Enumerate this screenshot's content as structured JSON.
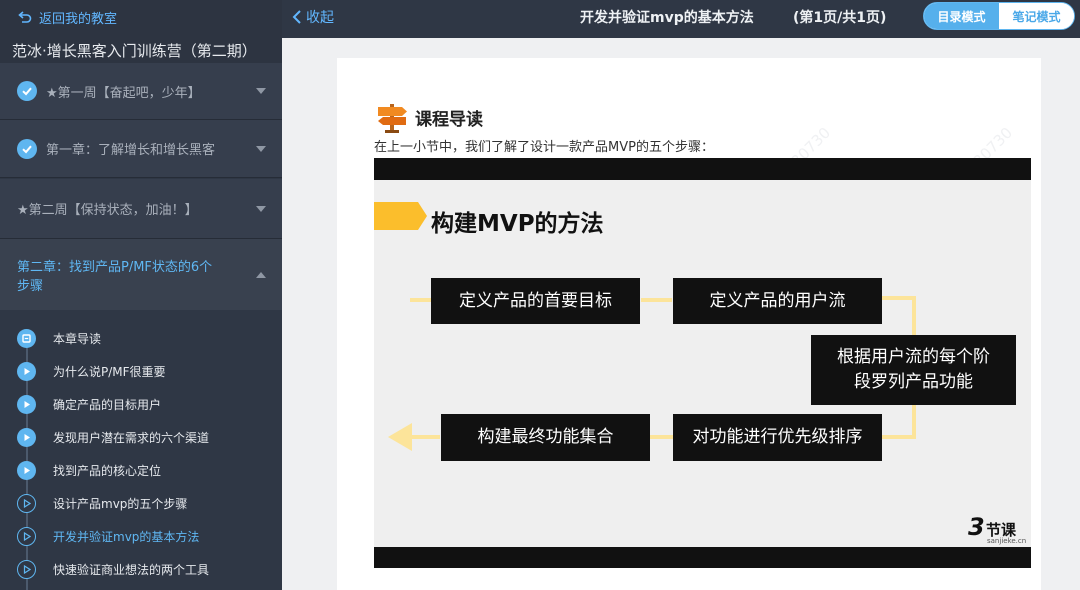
{
  "sidebar": {
    "back_label": "返回我的教室",
    "course_title": "范冰·增长黑客入门训练营（第二期）",
    "sections": [
      {
        "label": "★第一周【奋起吧，少年】",
        "checked": true
      },
      {
        "label": "第一章：了解增长和增长黑客",
        "checked": true
      },
      {
        "label": "★第二周【保持状态，加油！】",
        "checked": false
      }
    ],
    "active_section": "第二章：找到产品P/MF状态的6个步骤",
    "lessons": [
      {
        "label": "本章导读",
        "icon": "doc-icon",
        "state": "done"
      },
      {
        "label": "为什么说P/MF很重要",
        "icon": "play-icon",
        "state": "done"
      },
      {
        "label": "确定产品的目标用户",
        "icon": "play-icon",
        "state": "done"
      },
      {
        "label": "发现用户潜在需求的六个渠道",
        "icon": "play-icon",
        "state": "done"
      },
      {
        "label": "找到产品的核心定位",
        "icon": "play-icon",
        "state": "done"
      },
      {
        "label": "设计产品mvp的五个步骤",
        "icon": "play-icon",
        "state": "todo"
      },
      {
        "label": "开发并验证mvp的基本方法",
        "icon": "play-icon",
        "state": "current"
      },
      {
        "label": "快速验证商业想法的两个工具",
        "icon": "play-icon",
        "state": "todo"
      }
    ]
  },
  "topbar": {
    "collapse_label": "收起",
    "page_title": "开发并验证mvp的基本方法",
    "page_count": "(第1页/共1页)",
    "mode_catalog": "目录模式",
    "mode_notes": "笔记模式"
  },
  "content": {
    "guide_title": "课程导读",
    "intro_text": "在上一小节中，我们了解了设计一款产品MVP的五个步骤：",
    "watermark": "30730",
    "slide": {
      "title": "构建MVP的方法",
      "steps": [
        "定义产品的首要目标",
        "定义产品的用户流",
        "根据用户流的每个阶段罗列产品功能",
        "对功能进行优先级排序",
        "构建最终功能集合"
      ],
      "logo_number": "3",
      "logo_text": "节课",
      "logo_sub": "sanjieke.cn"
    }
  },
  "colors": {
    "accent": "#5fb6f0",
    "sidebar_bg": "#2f3745",
    "arrow_yellow": "#fce49a",
    "title_tag_yellow": "#fbbe2c"
  }
}
